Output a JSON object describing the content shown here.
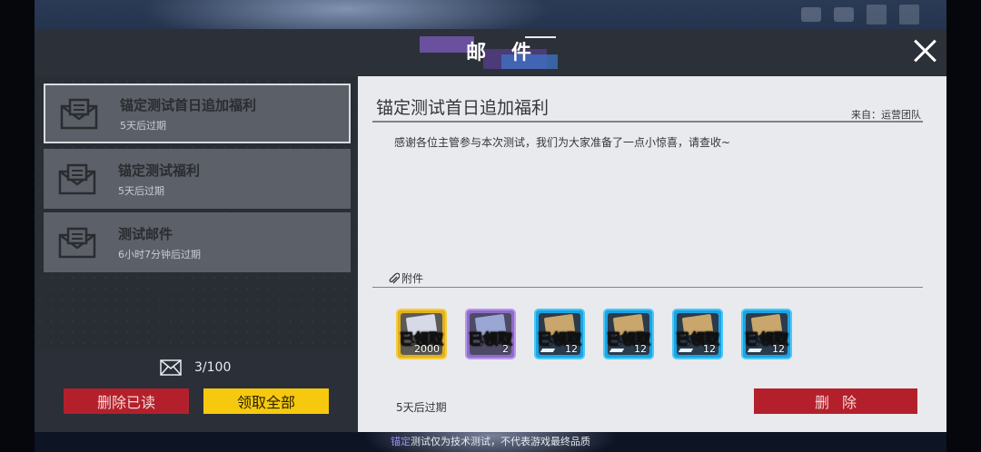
{
  "window": {
    "title": "邮 件",
    "close_icon": "close-icon"
  },
  "mail_list": [
    {
      "title": "锚定测试首日追加福利",
      "expiry": "5天后过期",
      "selected": true
    },
    {
      "title": "锚定测试福利",
      "expiry": "5天后过期",
      "selected": false
    },
    {
      "title": "测试邮件",
      "expiry": "6小时7分钟后过期",
      "selected": false
    }
  ],
  "mailbox": {
    "count": "3/100",
    "delete_read_label": "删除已读",
    "claim_all_label": "领取全部"
  },
  "detail": {
    "title": "锚定测试首日追加福利",
    "from": "来自：运营团队",
    "body": "感谢各位主管参与本次测试，我们为大家准备了一点小惊喜，请查收~",
    "attachments_label": "附件",
    "expiry": "5天后过期",
    "delete_label": "删除"
  },
  "attachments": [
    {
      "rarity": "gold",
      "status": "已领取",
      "qty": "2000"
    },
    {
      "rarity": "purple",
      "status": "已领取",
      "qty": "2"
    },
    {
      "rarity": "blue",
      "status": "已领取",
      "qty": "12"
    },
    {
      "rarity": "blue",
      "status": "已领取",
      "qty": "12"
    },
    {
      "rarity": "blue",
      "status": "已领取",
      "qty": "12"
    },
    {
      "rarity": "blue",
      "status": "已领取",
      "qty": "12"
    }
  ],
  "footer": {
    "accent": "锚定",
    "text": "测试仅为技术测试，不代表游戏最终品质"
  },
  "colors": {
    "delete_red": "#b3202b",
    "claim_yellow": "#f6c90e",
    "rarity_gold": "#e3b11d",
    "rarity_purple": "#8e6cc6",
    "rarity_blue": "#19a4e3"
  }
}
